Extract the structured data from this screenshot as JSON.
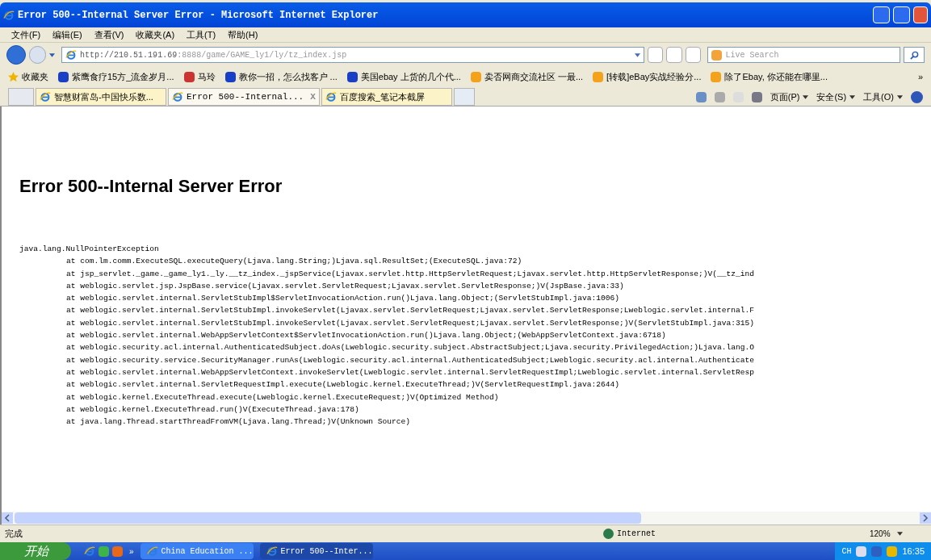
{
  "window": {
    "title": "Error 500--Internal Server Error - Microsoft Internet Explorer"
  },
  "menu": [
    "文件(F)",
    "编辑(E)",
    "查看(V)",
    "收藏夹(A)",
    "工具(T)",
    "帮助(H)"
  ],
  "address": {
    "host": "http://210.51.191.69",
    "rest": ":8888/game/GAME_ly1/ly/tz_index.jsp"
  },
  "search": {
    "placeholder": "Live Search"
  },
  "favorites": {
    "label": "收藏夹",
    "items": [
      "紫鹰食疗15方_流金岁月...",
      "马玲",
      "教你一招，怎么找客户 ...",
      "美国ebay 上货的几个代...",
      "卖否网商交流社区 一最...",
      "[转载]eBay实战经验分...",
      "除了Ebay, 你还能在哪里..."
    ],
    "more": "»"
  },
  "tabs": [
    {
      "label": "智慧财富岛-中国快乐数...",
      "selected": false
    },
    {
      "label": "Error 500--Internal...",
      "selected": true,
      "close": "X"
    },
    {
      "label": "百度搜索_笔记本截屏",
      "selected": false
    }
  ],
  "command_bar": [
    "页面(P)",
    "安全(S)",
    "工具(O)"
  ],
  "page": {
    "heading": "Error 500--Internal Server Error",
    "exception": "java.lang.NullPointerException",
    "trace": [
      "at com.lm.comm.ExecuteSQL.executeQuery(Ljava.lang.String;)Ljava.sql.ResultSet;(ExecuteSQL.java:72)",
      "at jsp_servlet._game._game_ly1._ly.__tz_index._jspService(Ljavax.servlet.http.HttpServletRequest;Ljavax.servlet.http.HttpServletResponse;)V(__tz_ind",
      "at weblogic.servlet.jsp.JspBase.service(Ljavax.servlet.ServletRequest;Ljavax.servlet.ServletResponse;)V(JspBase.java:33)",
      "at weblogic.servlet.internal.ServletStubImpl$ServletInvocationAction.run()Ljava.lang.Object;(ServletStubImpl.java:1006)",
      "at weblogic.servlet.internal.ServletStubImpl.invokeServlet(Ljavax.servlet.ServletRequest;Ljavax.servlet.ServletResponse;Lweblogic.servlet.internal.F",
      "at weblogic.servlet.internal.ServletStubImpl.invokeServlet(Ljavax.servlet.ServletRequest;Ljavax.servlet.ServletResponse;)V(ServletStubImpl.java:315)",
      "at weblogic.servlet.internal.WebAppServletContext$ServletInvocationAction.run()Ljava.lang.Object;(WebAppServletContext.java:6718)",
      "at weblogic.security.acl.internal.AuthenticatedSubject.doAs(Lweblogic.security.subject.AbstractSubject;Ljava.security.PrivilegedAction;)Ljava.lang.O",
      "at weblogic.security.service.SecurityManager.runAs(Lweblogic.security.acl.internal.AuthenticatedSubject;Lweblogic.security.acl.internal.Authenticate",
      "at weblogic.servlet.internal.WebAppServletContext.invokeServlet(Lweblogic.servlet.internal.ServletRequestImpl;Lweblogic.servlet.internal.ServletResp",
      "at weblogic.servlet.internal.ServletRequestImpl.execute(Lweblogic.kernel.ExecuteThread;)V(ServletRequestImpl.java:2644)",
      "at weblogic.kernel.ExecuteThread.execute(Lweblogic.kernel.ExecuteRequest;)V(Optimized Method)",
      "at weblogic.kernel.ExecuteThread.run()V(ExecuteThread.java:178)",
      "at java.lang.Thread.startThreadFromVM(Ljava.lang.Thread;)V(Unknown Source)"
    ]
  },
  "status_bar": {
    "text": "完成",
    "zone": "Internet",
    "zoom": "120%"
  },
  "taskbar": {
    "start": "开始",
    "more": "»",
    "tasks": [
      {
        "label": "China Education ...",
        "selected": false
      },
      {
        "label": "Error 500--Inter...",
        "selected": true
      }
    ],
    "lang": "CH",
    "clock": "16:35"
  }
}
